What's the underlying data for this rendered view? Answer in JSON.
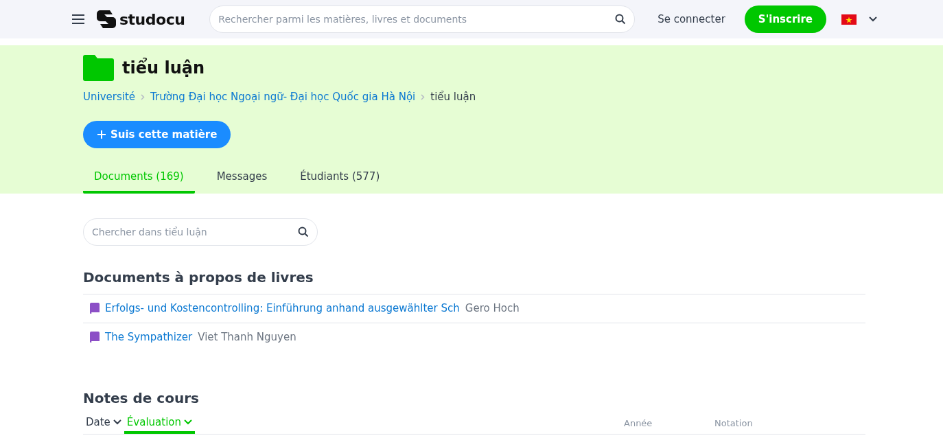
{
  "header": {
    "logo": "studocu",
    "search": {
      "placeholder": "Rechercher parmi les matières, livres et documents"
    },
    "login": "Se connecter",
    "signup": "S'inscrire"
  },
  "course": {
    "title": "tiểu luận",
    "breadcrumbs": [
      {
        "label": "Université",
        "kind": "link"
      },
      {
        "label": "Trường Đại học Ngoại ngữ- Đại học Quốc gia Hà Nội",
        "kind": "link"
      },
      {
        "label": "tiểu luận",
        "kind": "current"
      }
    ],
    "follow": "Suis cette matière",
    "tabs": [
      {
        "label": "Documents (169)",
        "selected": true
      },
      {
        "label": "Messages",
        "selected": false
      },
      {
        "label": "Étudiants (577)",
        "selected": false
      }
    ]
  },
  "filter": {
    "placeholder": "Chercher dans tiểu luận"
  },
  "books": {
    "heading": "Documents à propos de livres",
    "items": [
      {
        "title": "Erfolgs- und Kostencontrolling: Einführung anhand ausgewählter Sch",
        "author": "Gero Hoch"
      },
      {
        "title": "The Sympathizer",
        "author": "Viet Thanh Nguyen"
      }
    ]
  },
  "notes": {
    "heading": "Notes de cours",
    "sorts": [
      {
        "label": "Date",
        "selected": false
      },
      {
        "label": "Évaluation",
        "selected": true
      }
    ],
    "columns": [
      "Année",
      "Notation"
    ]
  }
}
